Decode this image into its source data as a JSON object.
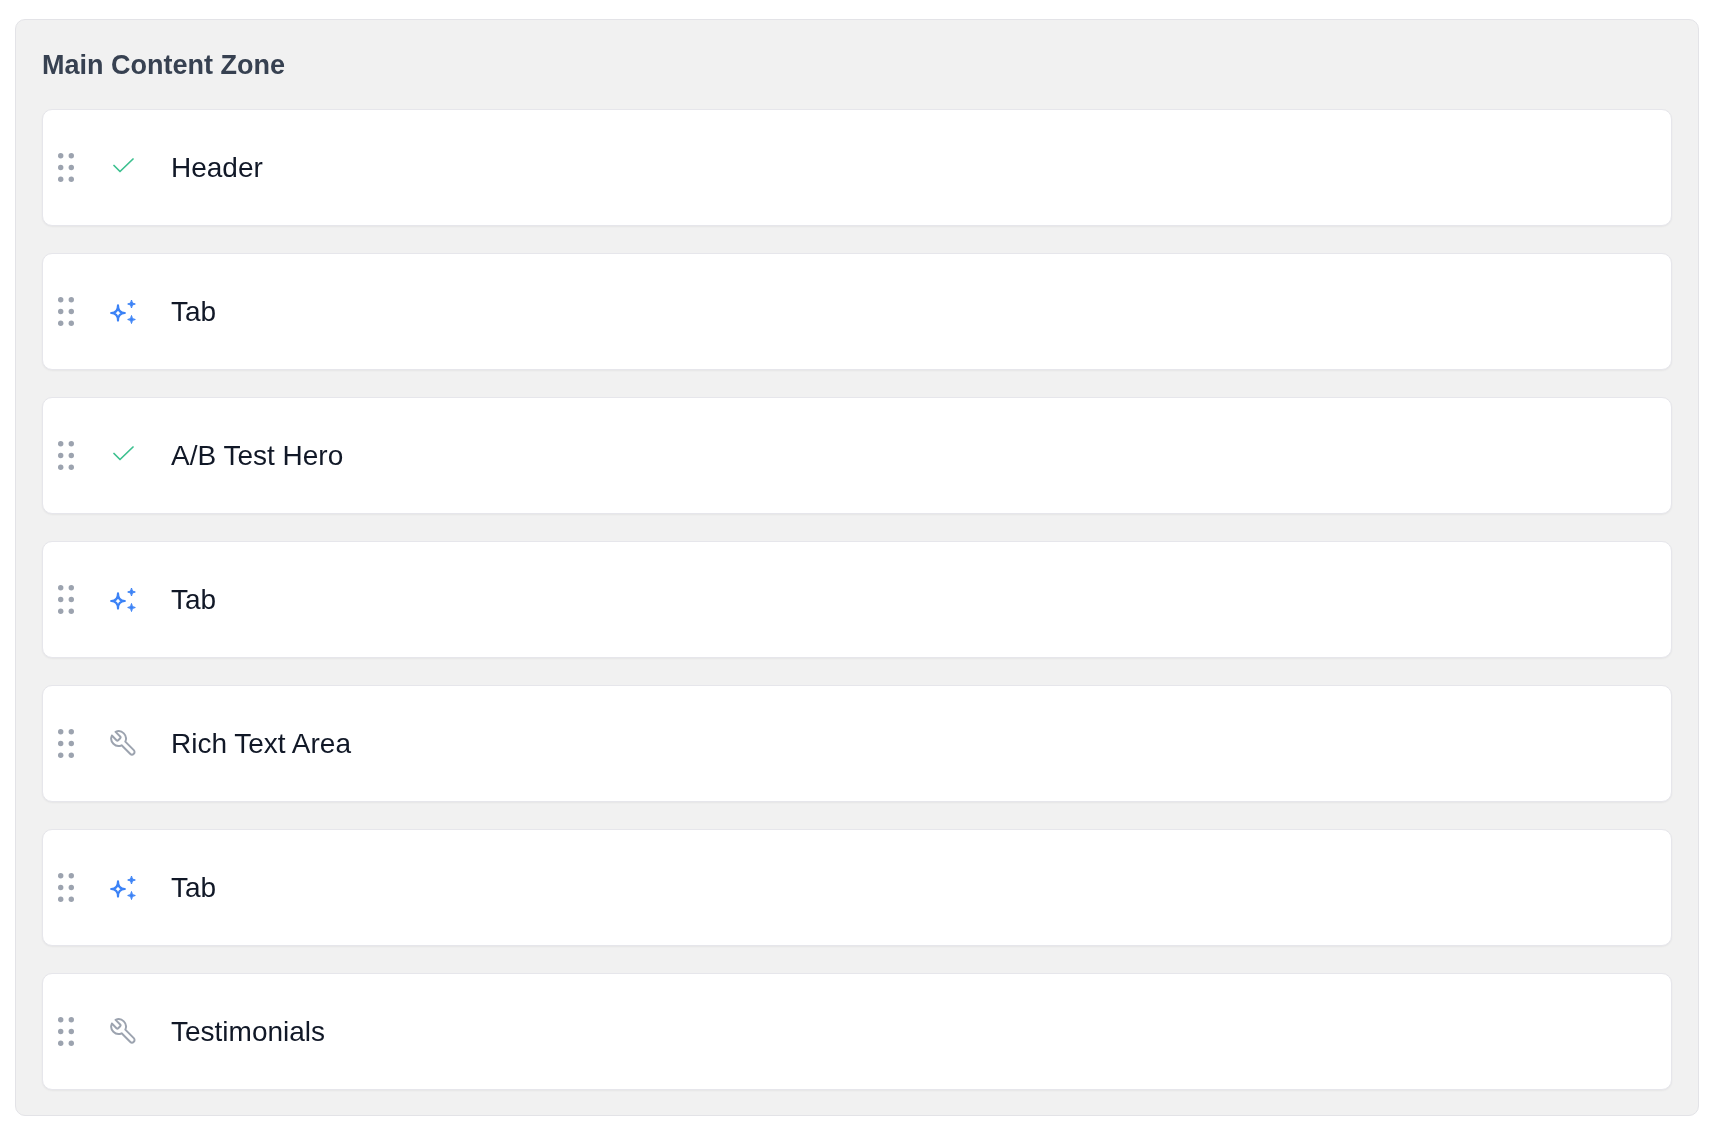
{
  "zone": {
    "title": "Main Content Zone",
    "blocks": [
      {
        "label": "Header",
        "kind": "check"
      },
      {
        "label": "Tab",
        "kind": "sparkle"
      },
      {
        "label": "A/B Test Hero",
        "kind": "check"
      },
      {
        "label": "Tab",
        "kind": "sparkle"
      },
      {
        "label": "Rich Text Area",
        "kind": "wrench"
      },
      {
        "label": "Tab",
        "kind": "sparkle"
      },
      {
        "label": "Testimonials",
        "kind": "wrench"
      }
    ]
  }
}
